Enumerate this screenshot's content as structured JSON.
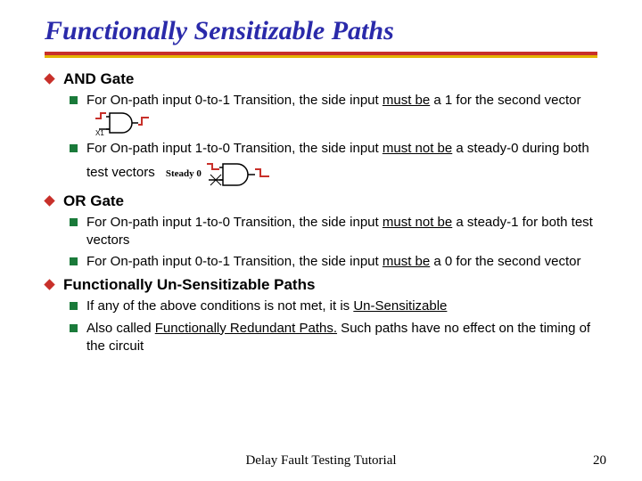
{
  "title": "Functionally Sensitizable Paths",
  "sections": [
    {
      "heading": "AND Gate",
      "items": [
        {
          "pre": "For On-path input 0-to-1 Transition, the side input ",
          "u": "must be",
          "post": " a 1 for the second vector",
          "gate": "and1",
          "labelX1": "X1"
        },
        {
          "pre": "For On-path input 1-to-0 Transition, the side input ",
          "u": "must not be",
          "post": " a steady-0 during both test vectors",
          "gate": "and2",
          "steady": "Steady 0"
        }
      ]
    },
    {
      "heading": "OR Gate",
      "items": [
        {
          "pre": "For On-path input 1-to-0 Transition, the side input ",
          "u": "must not be",
          "post": " a steady-1 for both test vectors"
        },
        {
          "pre": "For On-path input 0-to-1 Transition, the side input ",
          "u": "must be",
          "post": " a 0 for the second vector"
        }
      ]
    },
    {
      "heading": "Functionally Un-Sensitizable Paths",
      "items": [
        {
          "pre": "If any of the above conditions is not met, it is ",
          "u": "Un-Sensitizable",
          "post": ""
        },
        {
          "pre": "Also called ",
          "u": "Functionally Redundant Paths.",
          "post": " Such paths have no effect on the timing of the circuit"
        }
      ]
    }
  ],
  "footer": {
    "center": "Delay Fault Testing Tutorial",
    "page": "20"
  }
}
